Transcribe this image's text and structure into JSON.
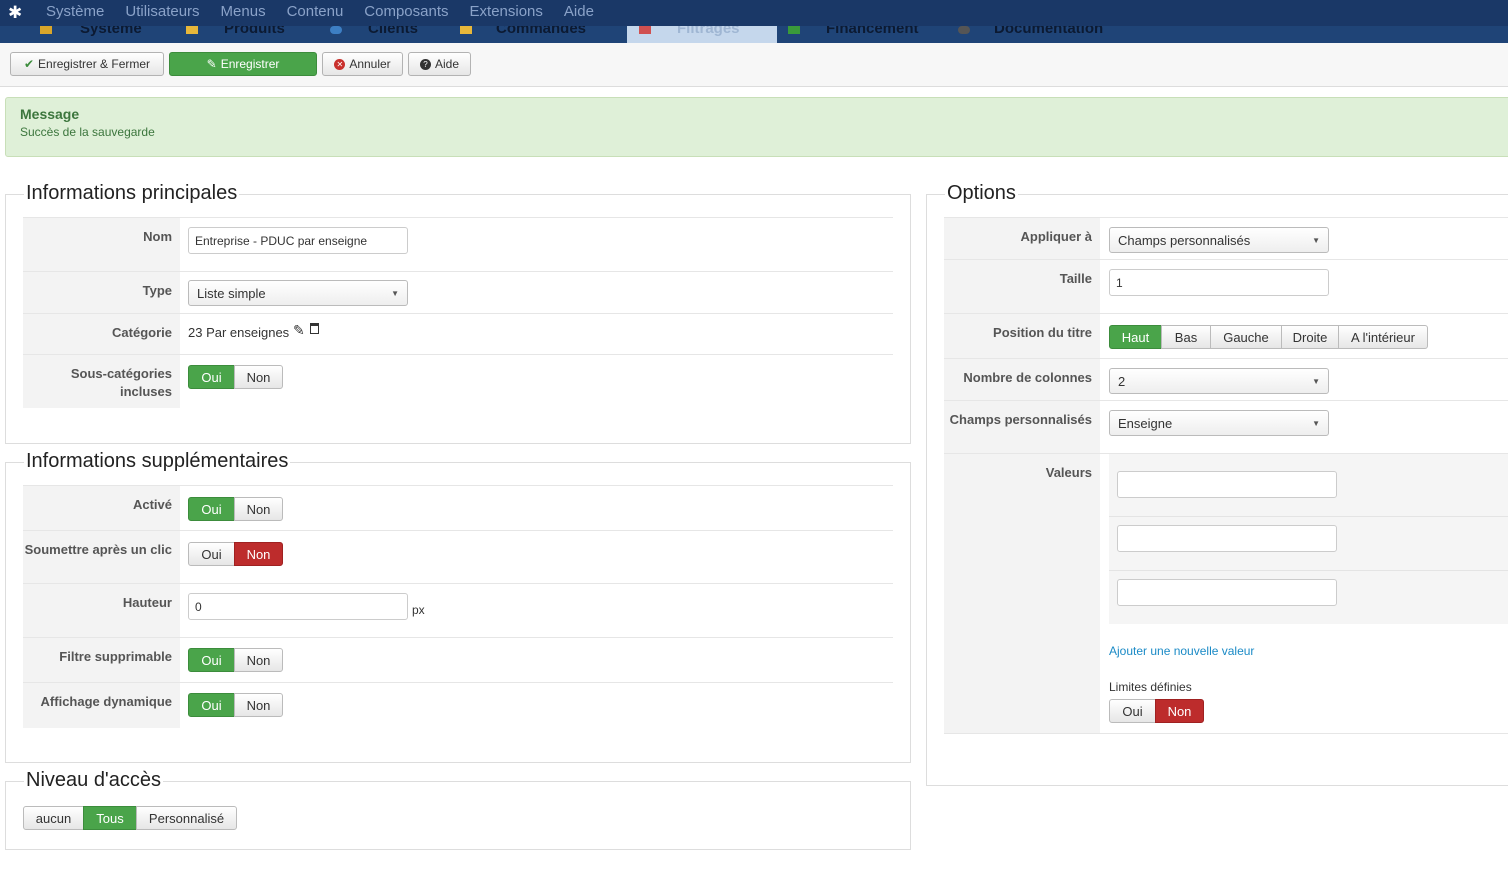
{
  "menubar": {
    "items": [
      "Système",
      "Utilisateurs",
      "Menus",
      "Contenu",
      "Composants",
      "Extensions",
      "Aide"
    ],
    "subtabs": [
      "Système",
      "Produits",
      "Clients",
      "Commandes",
      "Filtrages",
      "Financement",
      "Documentation"
    ]
  },
  "toolbar": {
    "save_close": "Enregistrer & Fermer",
    "save": "Enregistrer",
    "cancel": "Annuler",
    "help": "Aide"
  },
  "alert": {
    "title": "Message",
    "text": "Succès de la sauvegarde"
  },
  "main": {
    "legend": "Informations principales",
    "nom_label": "Nom",
    "nom_value": "Entreprise - PDUC par enseigne",
    "type_label": "Type",
    "type_value": "Liste simple",
    "categorie_label": "Catégorie",
    "categorie_value": "23 Par enseignes",
    "souscat_label": "Sous-catégories incluses",
    "yes": "Oui",
    "no": "Non"
  },
  "extra": {
    "legend": "Informations supplémentaires",
    "active_label": "Activé",
    "submit_label": "Soumettre après un clic",
    "height_label": "Hauteur",
    "height_value": "0",
    "height_unit": "px",
    "removable_label": "Filtre supprimable",
    "dynamic_label": "Affichage dynamique"
  },
  "access": {
    "legend": "Niveau d'accès",
    "options": [
      "aucun",
      "Tous",
      "Personnalisé"
    ],
    "selected": "Tous"
  },
  "options": {
    "legend": "Options",
    "apply_label": "Appliquer à",
    "apply_value": "Champs personnalisés",
    "size_label": "Taille",
    "size_value": "1",
    "title_pos_label": "Position du titre",
    "title_pos_options": [
      "Haut",
      "Bas",
      "Gauche",
      "Droite",
      "A l'intérieur"
    ],
    "title_pos_selected": "Haut",
    "columns_label": "Nombre de colonnes",
    "columns_value": "2",
    "fields_label": "Champs personnalisés",
    "fields_value": "Enseigne",
    "values_label": "Valeurs",
    "add_value_link": "Ajouter une nouvelle valeur",
    "limits_label": "Limites définies"
  },
  "colors": {
    "green": "#4aa44a",
    "red": "#bd2c2c",
    "navbar": "#1a3867"
  }
}
